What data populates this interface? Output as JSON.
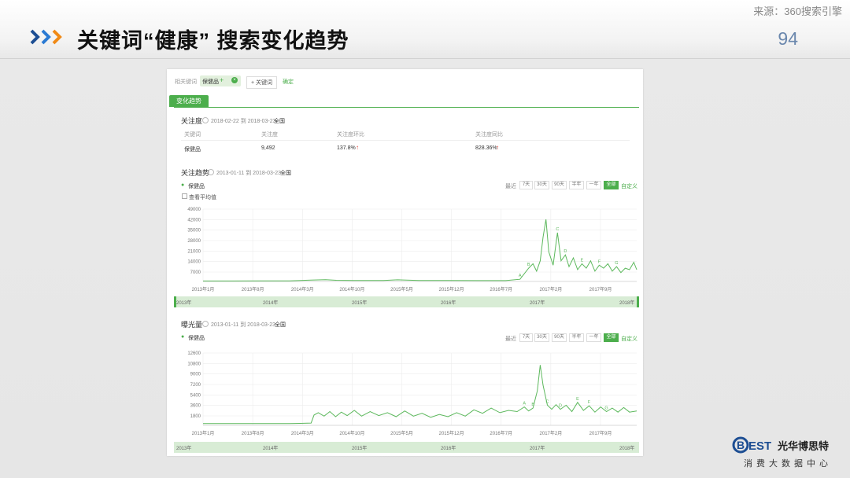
{
  "slide": {
    "title": "关键词“健康” 搜索变化趋势",
    "source": "来源：360搜索引擎",
    "page_number": "94"
  },
  "toolbar": {
    "related_label": "相关键词",
    "keyword": "保健品",
    "add_keyword": "+ 关键词",
    "confirm": "确定"
  },
  "section_tab": "变化趋势",
  "attention": {
    "title": "关注度",
    "date_range": "2018-02-22 到 2018-03-23",
    "region": "全国",
    "headers": [
      "关键词",
      "关注度",
      "关注度环比",
      "关注度同比"
    ],
    "row": {
      "keyword": "保健品",
      "value": "9,492",
      "mom": "137.8%",
      "yoy": "828.36%"
    }
  },
  "trend": {
    "title": "关注趋势",
    "date_range": "2013-01-11 到 2018-03-23",
    "region": "全国",
    "legend": "保健品",
    "avg_label": "查看平均值",
    "ranges": [
      "最近",
      "7天",
      "30天",
      "90天",
      "半年",
      "一年",
      "全部",
      "自定义"
    ],
    "active_range": "全部",
    "y_ticks": [
      "49000",
      "42000",
      "35000",
      "28000",
      "21000",
      "14000",
      "7000"
    ],
    "x_ticks": [
      "2013年1月",
      "2013年8月",
      "2014年3月",
      "2014年10月",
      "2015年5月",
      "2015年12月",
      "2016年7月",
      "2017年2月",
      "2017年9月"
    ],
    "timeline": [
      "2013年",
      "2014年",
      "2015年",
      "2016年",
      "2017年",
      "2018年"
    ],
    "markers": [
      "A",
      "B",
      "C",
      "D",
      "E",
      "F",
      "G"
    ]
  },
  "exposure": {
    "title": "曝光量",
    "date_range": "2013-01-11 到 2018-03-23",
    "region": "全国",
    "legend": "保健品",
    "ranges": [
      "最近",
      "7天",
      "30天",
      "90天",
      "半年",
      "一年",
      "全部",
      "自定义"
    ],
    "active_range": "全部",
    "y_ticks": [
      "12600",
      "10800",
      "9000",
      "7200",
      "5400",
      "3600",
      "1800"
    ],
    "x_ticks": [
      "2013年1月",
      "2013年8月",
      "2014年3月",
      "2014年10月",
      "2015年5月",
      "2015年12月",
      "2016年7月",
      "2017年2月",
      "2017年9月"
    ],
    "timeline": [
      "2013年",
      "2014年",
      "2015年",
      "2016年",
      "2017年",
      "2018年"
    ],
    "markers": [
      "A",
      "B",
      "C",
      "D",
      "E",
      "F",
      "G"
    ]
  },
  "chart_data": [
    {
      "type": "line",
      "title": "关注趋势",
      "ylim": [
        0,
        49000
      ],
      "series": [
        {
          "name": "保健品",
          "points": [
            [
              0,
              300
            ],
            [
              40,
              320
            ],
            [
              80,
              350
            ],
            [
              120,
              400
            ],
            [
              150,
              900
            ],
            [
              170,
              1200
            ],
            [
              185,
              800
            ],
            [
              210,
              700
            ],
            [
              250,
              650
            ],
            [
              270,
              1100
            ],
            [
              300,
              700
            ],
            [
              340,
              650
            ],
            [
              380,
              600
            ],
            [
              420,
              600
            ],
            [
              440,
              1500
            ],
            [
              452,
              9000
            ],
            [
              458,
              12000
            ],
            [
              463,
              7000
            ],
            [
              468,
              14000
            ],
            [
              472,
              30000
            ],
            [
              476,
              42000
            ],
            [
              480,
              20000
            ],
            [
              486,
              11000
            ],
            [
              492,
              33000
            ],
            [
              497,
              14000
            ],
            [
              503,
              18000
            ],
            [
              508,
              10000
            ],
            [
              514,
              16000
            ],
            [
              520,
              8000
            ],
            [
              526,
              12000
            ],
            [
              532,
              9000
            ],
            [
              538,
              14000
            ],
            [
              544,
              7000
            ],
            [
              550,
              11000
            ],
            [
              556,
              9000
            ],
            [
              562,
              12000
            ],
            [
              568,
              7000
            ],
            [
              574,
              10000
            ],
            [
              580,
              6000
            ],
            [
              586,
              9000
            ],
            [
              592,
              8000
            ],
            [
              598,
              13000
            ],
            [
              602,
              8000
            ]
          ]
        }
      ]
    },
    {
      "type": "line",
      "title": "曝光量",
      "ylim": [
        0,
        12600
      ],
      "series": [
        {
          "name": "保健品",
          "points": [
            [
              0,
              300
            ],
            [
              60,
              300
            ],
            [
              120,
              300
            ],
            [
              150,
              400
            ],
            [
              154,
              1800
            ],
            [
              160,
              2200
            ],
            [
              168,
              1600
            ],
            [
              176,
              2400
            ],
            [
              184,
              1500
            ],
            [
              192,
              2300
            ],
            [
              200,
              1700
            ],
            [
              210,
              2600
            ],
            [
              220,
              1600
            ],
            [
              232,
              2400
            ],
            [
              244,
              1700
            ],
            [
              256,
              2200
            ],
            [
              268,
              1500
            ],
            [
              280,
              2500
            ],
            [
              292,
              1600
            ],
            [
              304,
              2100
            ],
            [
              316,
              1400
            ],
            [
              328,
              1900
            ],
            [
              340,
              1500
            ],
            [
              352,
              2200
            ],
            [
              364,
              1600
            ],
            [
              376,
              2700
            ],
            [
              388,
              2100
            ],
            [
              400,
              3000
            ],
            [
              412,
              2200
            ],
            [
              424,
              2600
            ],
            [
              436,
              2400
            ],
            [
              446,
              3200
            ],
            [
              452,
              2500
            ],
            [
              458,
              3000
            ],
            [
              464,
              6000
            ],
            [
              468,
              10500
            ],
            [
              472,
              7000
            ],
            [
              478,
              3500
            ],
            [
              484,
              2800
            ],
            [
              490,
              3600
            ],
            [
              496,
              2800
            ],
            [
              504,
              3500
            ],
            [
              512,
              2400
            ],
            [
              520,
              4000
            ],
            [
              528,
              2600
            ],
            [
              536,
              3400
            ],
            [
              544,
              2300
            ],
            [
              552,
              3200
            ],
            [
              560,
              2400
            ],
            [
              568,
              3000
            ],
            [
              576,
              2300
            ],
            [
              584,
              3100
            ],
            [
              592,
              2300
            ],
            [
              602,
              2500
            ]
          ]
        }
      ]
    }
  ]
}
